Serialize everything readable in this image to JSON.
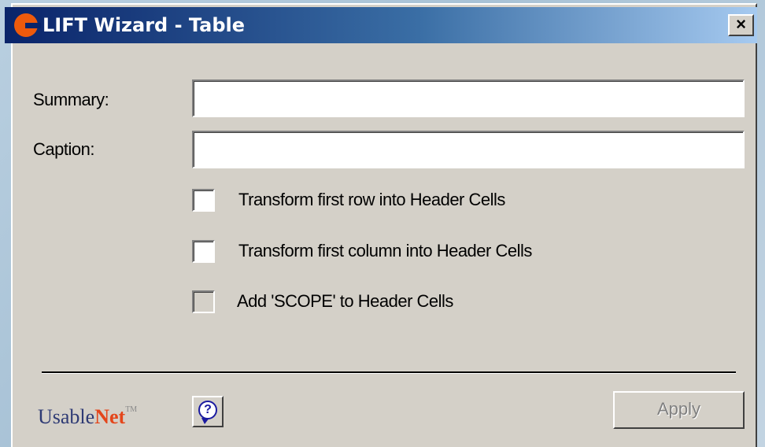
{
  "window": {
    "title": "LIFT Wizard - Table",
    "close_label": "×"
  },
  "form": {
    "summary_label": "Summary:",
    "summary_value": "",
    "caption_label": "Caption:",
    "caption_value": ""
  },
  "options": [
    {
      "label": "Transform first row into Header Cells",
      "checked": false,
      "enabled": true
    },
    {
      "label": "Transform first column into Header Cells",
      "checked": false,
      "enabled": true
    },
    {
      "label": "Add 'SCOPE' to Header Cells",
      "checked": false,
      "enabled": false
    }
  ],
  "footer": {
    "brand_usable": "Usable",
    "brand_net": "Net",
    "brand_tm": "TM",
    "help_label": "?",
    "apply_label": "Apply"
  },
  "colors": {
    "accent": "#ee5a0c",
    "titlebar_start": "#0a246a",
    "titlebar_end": "#a6caf0",
    "dialog_bg": "#d4d0c8"
  }
}
